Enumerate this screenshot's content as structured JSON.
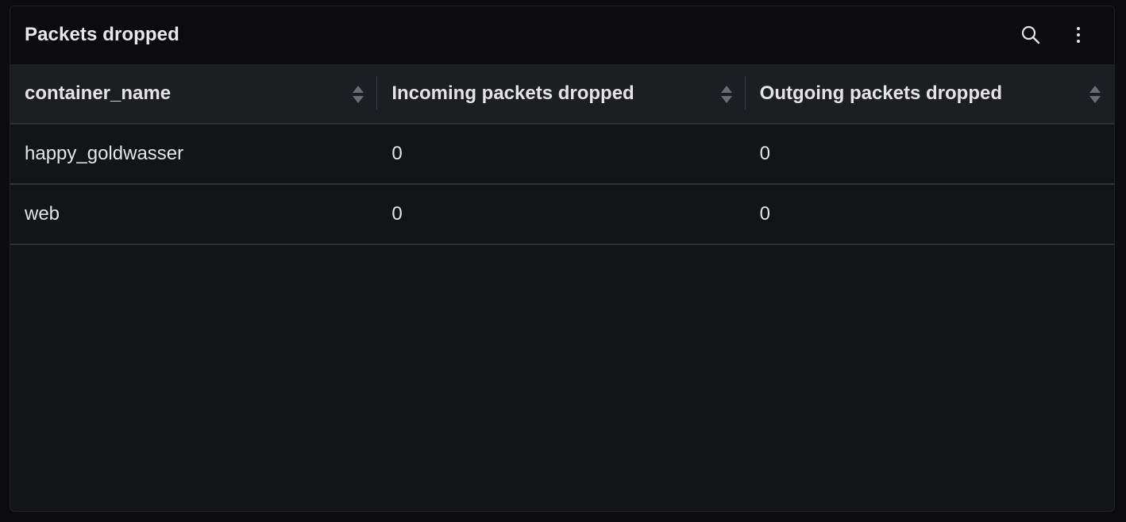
{
  "panel": {
    "title": "Packets dropped",
    "actions": [
      {
        "name": "search",
        "icon": "search-icon"
      },
      {
        "name": "menu",
        "icon": "kebab-menu-icon"
      }
    ]
  },
  "table": {
    "columns": [
      {
        "label": "container_name",
        "sortable": true
      },
      {
        "label": "Incoming packets dropped",
        "sortable": true
      },
      {
        "label": "Outgoing packets dropped",
        "sortable": true
      }
    ],
    "rows": [
      [
        "happy_goldwasser",
        "0",
        "0"
      ],
      [
        "web",
        "0",
        "0"
      ]
    ]
  },
  "colors": {
    "background": "#0c0c0e",
    "panel": "#131418",
    "header_row": "#1d1e22",
    "text": "#e4e4e6",
    "sort_icon": "#6b6c72"
  }
}
